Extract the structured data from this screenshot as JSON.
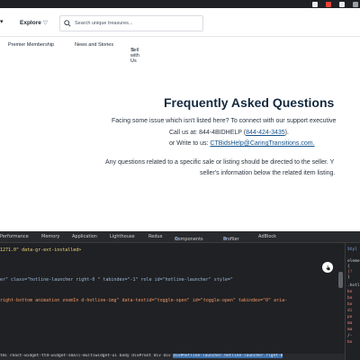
{
  "header": {
    "explore_label": "Explore",
    "explore_chevron": "▽",
    "search_placeholder": "Search unique treasures..."
  },
  "nav": {
    "items": [
      "Premier Membership",
      "News and Stories",
      "Sell with Us"
    ]
  },
  "faq": {
    "title": "Frequently Asked Questions",
    "line1": "Facing some issue which isn't listed here? To connect with our support executive",
    "line2_prefix": "Call us at: 844-4BIDHELP (",
    "line2_link": "844-424-3435",
    "line2_suffix": ").",
    "line3_prefix": "or Write to us: ",
    "line3_link": "CTBidsHelp@CaringTransitions.com.",
    "line4": "Any questions related to a specific sale or listing should be directed to the seller. Y",
    "line5": "seller's information below the related item listing."
  },
  "devtools": {
    "tabs": [
      "Performance",
      "Memory",
      "Application",
      "Lighthouse",
      "Redux",
      "Components",
      "Profiler",
      "AdBlock"
    ],
    "code_line1": "1271.0\" data-gr-ext-installed>",
    "code_line2": "er\" class=\"hotline-launcher right-0    \" tabindex=\"-1\" role id=\"hotline-launcher\" style=\"",
    "code_line3": "right-bottom animation zoomIn   d-hotline-img\" data-testid=\"toggle-open\" id=\"toggle-open\" tabindex=\"0\" aria-",
    "breadcrumb_left": "tml  react-widget-ttd-widget-small-multiwidget-ui   body  div#root   div   div  ",
    "breadcrumb_selected": "div#hotline-launcher.hotline-launcher.right-0",
    "styles_label": "Styl",
    "styles_lines": [
      "eleme",
      "{",
      "(!",
      "}",
      ".hotl",
      "bo",
      "bo",
      "bo",
      "di",
      "po",
      "ma",
      "ma",
      "/-",
      "bo"
    ]
  },
  "colors": {
    "title": "#152a3f",
    "link": "#16528a",
    "devtools_bg": "#202124"
  }
}
